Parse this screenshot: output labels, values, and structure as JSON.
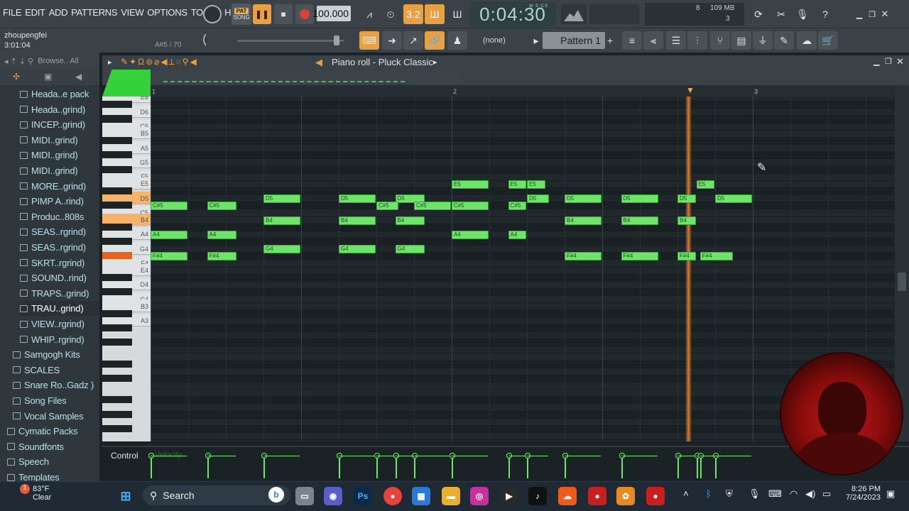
{
  "menu": [
    "FILE",
    "EDIT",
    "ADD",
    "PATTERNS",
    "VIEW",
    "OPTIONS",
    "TOOLS",
    "HELP"
  ],
  "transport": {
    "pat_label": "PAT",
    "song_label": "SONG",
    "tempo": "100.000",
    "time": "0:04:30",
    "time_unit": "M:S:CS"
  },
  "stats": {
    "cpu_top": "8",
    "mem": "109 MB",
    "voices": "3"
  },
  "hint": {
    "user": "zhoupengfei",
    "time": "3:01:04",
    "note": "A#5 / 70"
  },
  "toolbar2": {
    "channel_select": "(none)",
    "pattern": "Pattern 1"
  },
  "browser": {
    "head": "Browse.. All",
    "items": [
      {
        "label": "Heada..e pack",
        "indent": 1
      },
      {
        "label": "Heada..grind)",
        "indent": 1
      },
      {
        "label": "INCEP..grind)",
        "indent": 1
      },
      {
        "label": "MIDI..grind)",
        "indent": 1
      },
      {
        "label": "MIDI..grind)",
        "indent": 1
      },
      {
        "label": "MIDI..grind)",
        "indent": 1
      },
      {
        "label": "MORE..grind)",
        "indent": 1
      },
      {
        "label": "PIMP A..rind)",
        "indent": 1
      },
      {
        "label": "Produc..808s",
        "indent": 1
      },
      {
        "label": "SEAS..rgrind)",
        "indent": 1
      },
      {
        "label": "SEAS..rgrind)",
        "indent": 1
      },
      {
        "label": "SKRT..rgrind)",
        "indent": 1
      },
      {
        "label": "SOUND..rind)",
        "indent": 1
      },
      {
        "label": "TRAPS..grind)",
        "indent": 1
      },
      {
        "label": "TRAU..grind)",
        "indent": 1,
        "selected": true
      },
      {
        "label": "VIEW..rgrind)",
        "indent": 1
      },
      {
        "label": "WHIP..rgrind)",
        "indent": 1
      },
      {
        "label": "Samgogh Kits",
        "indent": 0
      },
      {
        "label": "SCALES",
        "indent": 0
      },
      {
        "label": "Snare Ro..Gadz )",
        "indent": 0
      },
      {
        "label": "Song Files",
        "indent": 0
      },
      {
        "label": "Vocal Samples",
        "indent": 0
      },
      {
        "label": "Cymatic Packs",
        "indent": -1
      },
      {
        "label": "Soundfonts",
        "indent": -1
      },
      {
        "label": "Speech",
        "indent": -1
      },
      {
        "label": "Templates",
        "indent": -1
      }
    ]
  },
  "pianoroll": {
    "title": "Piano roll - Pluck Classic",
    "ruler": [
      "1",
      "2",
      "3"
    ],
    "keys": [
      {
        "label": "E6"
      },
      {
        "label": "D6"
      },
      {
        "label": "C6"
      },
      {
        "label": "B5"
      },
      {
        "label": "A5"
      },
      {
        "label": "G5"
      },
      {
        "label": "F5"
      },
      {
        "label": "E5"
      },
      {
        "label": "D5"
      },
      {
        "label": "C5"
      },
      {
        "label": "B4"
      },
      {
        "label": "A4"
      },
      {
        "label": "G4"
      },
      {
        "label": "F4"
      },
      {
        "label": "E4"
      },
      {
        "label": "D4"
      },
      {
        "label": "C4"
      },
      {
        "label": "B3"
      },
      {
        "label": "A3"
      }
    ],
    "notes": [
      {
        "n": "C#5",
        "s": 0,
        "l": 1
      },
      {
        "n": "C#5",
        "s": 1.5,
        "l": 0.8
      },
      {
        "n": "D5",
        "s": 3,
        "l": 1
      },
      {
        "n": "D5",
        "s": 5,
        "l": 1
      },
      {
        "n": "D5",
        "s": 6.5,
        "l": 0.8
      },
      {
        "n": "C#5",
        "s": 6,
        "l": 0.6
      },
      {
        "n": "C#5",
        "s": 7,
        "l": 1
      },
      {
        "n": "C#5",
        "s": 8,
        "l": 1
      },
      {
        "n": "E5",
        "s": 8,
        "l": 1
      },
      {
        "n": "E5",
        "s": 9.5,
        "l": 0.5
      },
      {
        "n": "E5",
        "s": 10,
        "l": 0.5
      },
      {
        "n": "C#5",
        "s": 9.5,
        "l": 0.5
      },
      {
        "n": "D5",
        "s": 10,
        "l": 0.6
      },
      {
        "n": "D5",
        "s": 11,
        "l": 1
      },
      {
        "n": "D5",
        "s": 12.5,
        "l": 1
      },
      {
        "n": "D5",
        "s": 14,
        "l": 0.5
      },
      {
        "n": "E5",
        "s": 14.5,
        "l": 0.5
      },
      {
        "n": "D5",
        "s": 15,
        "l": 1
      },
      {
        "n": "B4",
        "s": 3,
        "l": 1
      },
      {
        "n": "B4",
        "s": 5,
        "l": 1
      },
      {
        "n": "B4",
        "s": 6.5,
        "l": 0.8
      },
      {
        "n": "B4",
        "s": 11,
        "l": 1
      },
      {
        "n": "B4",
        "s": 12.5,
        "l": 1
      },
      {
        "n": "B4",
        "s": 14,
        "l": 0.5
      },
      {
        "n": "A4",
        "s": 0,
        "l": 1
      },
      {
        "n": "A4",
        "s": 1.5,
        "l": 0.8
      },
      {
        "n": "A4",
        "s": 8,
        "l": 1
      },
      {
        "n": "A4",
        "s": 9.5,
        "l": 0.5
      },
      {
        "n": "G4",
        "s": 3,
        "l": 1
      },
      {
        "n": "G4",
        "s": 5,
        "l": 1
      },
      {
        "n": "G4",
        "s": 6.5,
        "l": 0.8
      },
      {
        "n": "F#4",
        "s": 0,
        "l": 1
      },
      {
        "n": "F#4",
        "s": 1.5,
        "l": 0.8
      },
      {
        "n": "F#4",
        "s": 11,
        "l": 1
      },
      {
        "n": "F#4",
        "s": 12.5,
        "l": 1
      },
      {
        "n": "F#4",
        "s": 14,
        "l": 0.5
      },
      {
        "n": "F#4",
        "s": 14.6,
        "l": 0.9
      }
    ],
    "control_label": "Control",
    "control_sub": "Velocity"
  },
  "taskbar": {
    "weather_temp": "83°F",
    "weather_desc": "Clear",
    "search": "Search",
    "time": "8:26 PM",
    "date": "7/24/2023"
  },
  "colors": {
    "note": "#6ee46a",
    "playhead": "#e07a2a",
    "accent": "#f3b04b"
  }
}
